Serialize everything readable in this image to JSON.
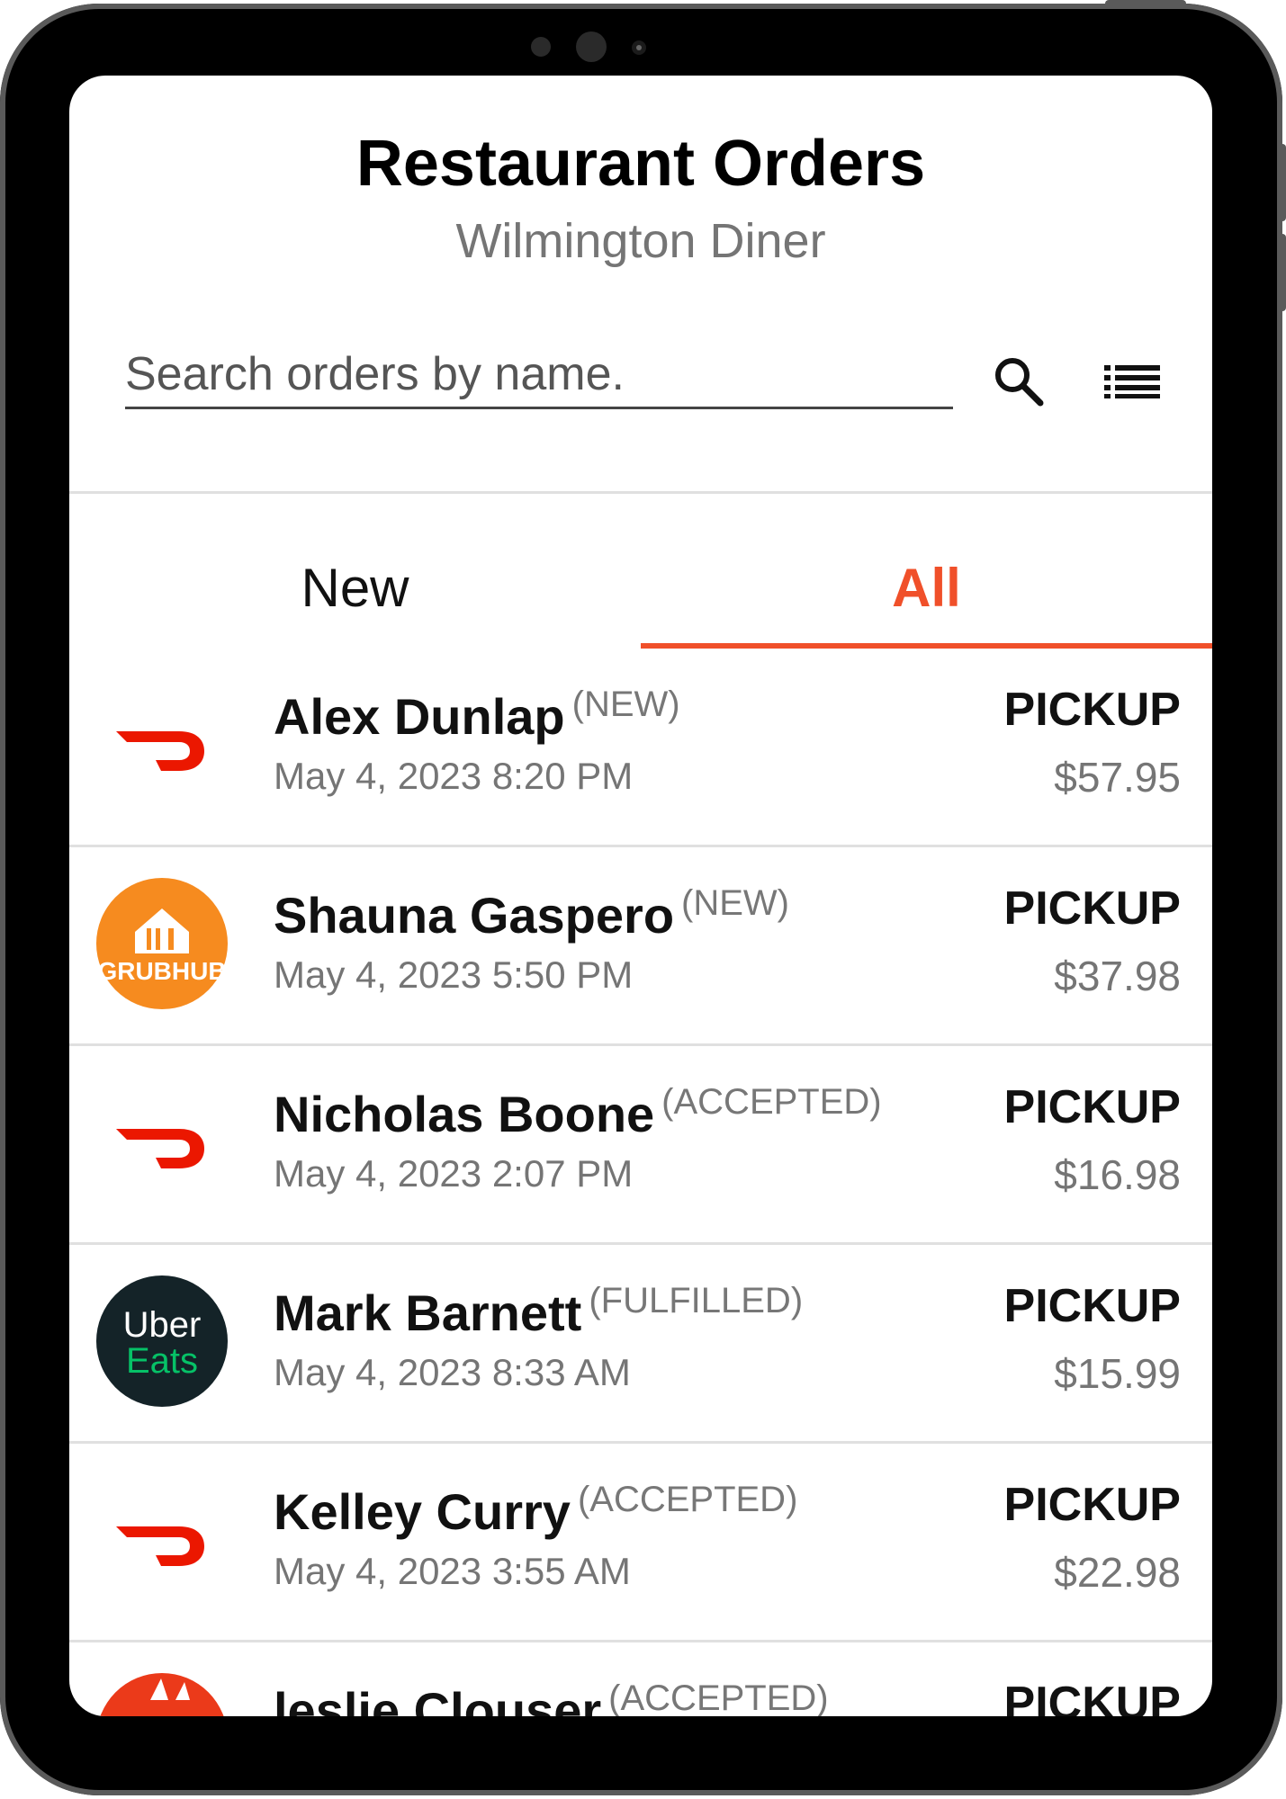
{
  "header": {
    "title": "Restaurant Orders",
    "subtitle": "Wilmington Diner"
  },
  "search": {
    "placeholder": "Search orders by name.",
    "value": ""
  },
  "tabs": [
    {
      "label": "New",
      "active": false
    },
    {
      "label": "All",
      "active": true
    }
  ],
  "colors": {
    "accent": "#f0502a",
    "doordash": "#eb1700",
    "grubhub": "#f68b1f",
    "ubereats_bg": "#142328",
    "ubereats_green": "#06c167"
  },
  "orders": [
    {
      "name": "Alex Dunlap",
      "status": "(NEW)",
      "date": "May 4, 2023 8:20 PM",
      "type": "PICKUP",
      "price": "$57.95",
      "provider": "doordash-icon"
    },
    {
      "name": "Shauna Gaspero",
      "status": "(NEW)",
      "date": "May 4, 2023 5:50 PM",
      "type": "PICKUP",
      "price": "$37.98",
      "provider": "grubhub-icon",
      "logo_text": "GRUBHUB"
    },
    {
      "name": "Nicholas Boone",
      "status": "(ACCEPTED)",
      "date": "May 4, 2023 2:07 PM",
      "type": "PICKUP",
      "price": "$16.98",
      "provider": "doordash-icon"
    },
    {
      "name": "Mark Barnett",
      "status": "(FULFILLED)",
      "date": "May 4, 2023 8:33 AM",
      "type": "PICKUP",
      "price": "$15.99",
      "provider": "ubereats-icon",
      "logo_text": [
        "Uber",
        "Eats"
      ]
    },
    {
      "name": "Kelley Curry",
      "status": "(ACCEPTED)",
      "date": "May 4, 2023 3:55 AM",
      "type": "PICKUP",
      "price": "$22.98",
      "provider": "doordash-icon"
    },
    {
      "name": "leslie  Clouser",
      "status": "(ACCEPTED)",
      "date": "",
      "type": "PICKUP",
      "price": "",
      "provider": "grubhub-icon"
    }
  ]
}
